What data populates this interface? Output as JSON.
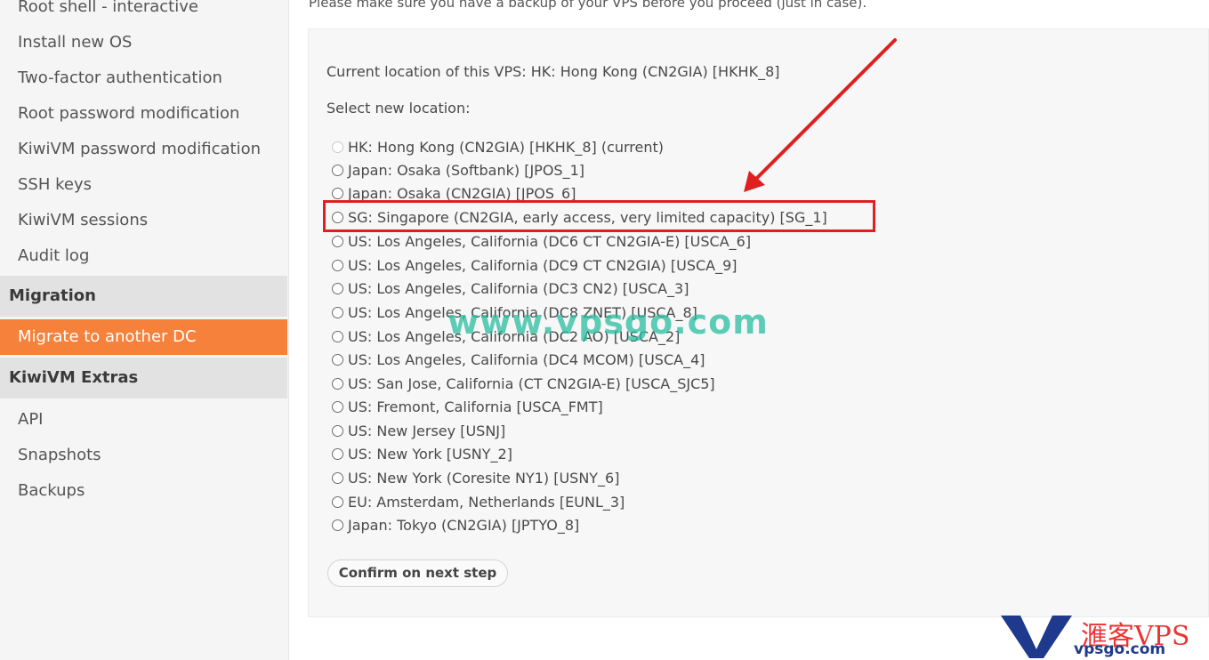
{
  "sidebar": {
    "items_top": [
      "Root shell - interactive",
      "Install new OS",
      "Two-factor authentication",
      "Root password modification",
      "KiwiVM password modification",
      "SSH keys",
      "KiwiVM sessions",
      "Audit log"
    ],
    "section_migration": "Migration",
    "active_item": "Migrate to another DC",
    "section_extras": "KiwiVM Extras",
    "items_extras": [
      "API",
      "Snapshots",
      "Backups"
    ]
  },
  "main": {
    "top_note": "Please make sure you have a backup of your VPS before you proceed (just in case).",
    "current_location": "Current location of this VPS: HK: Hong Kong (CN2GIA) [HKHK_8]",
    "select_label": "Select new location:",
    "options": [
      "HK: Hong Kong (CN2GIA) [HKHK_8] (current)",
      "Japan: Osaka (Softbank) [JPOS_1]",
      "Japan: Osaka (CN2GIA) [JPOS_6]",
      "SG: Singapore (CN2GIA, early access, very limited capacity) [SG_1]",
      "US: Los Angeles, California (DC6 CT CN2GIA-E) [USCA_6]",
      "US: Los Angeles, California (DC9 CT CN2GIA) [USCA_9]",
      "US: Los Angeles, California (DC3 CN2) [USCA_3]",
      "US: Los Angeles, California (DC8 ZNET) [USCA_8]",
      "US: Los Angeles, California (DC2 AO) [USCA_2]",
      "US: Los Angeles, California (DC4 MCOM) [USCA_4]",
      "US: San Jose, California (CT CN2GIA-E) [USCA_SJC5]",
      "US: Fremont, California [USCA_FMT]",
      "US: New Jersey [USNJ]",
      "US: New York [USNY_2]",
      "US: New York (Coresite NY1) [USNY_6]",
      "EU: Amsterdam, Netherlands [EUNL_3]",
      "Japan: Tokyo (CN2GIA) [JPTYO_8]"
    ],
    "confirm_button": "Confirm on next step"
  },
  "annotation": {
    "color": "#e02020",
    "watermark": "www.vpsgo.com"
  },
  "logo": {
    "text_cn": "滙客VPS",
    "text_url": "vpsgo.com"
  },
  "colors": {
    "accent": "#f5813a",
    "section_bg": "#e2e2e2",
    "panel_bg": "#f7f7f7"
  }
}
